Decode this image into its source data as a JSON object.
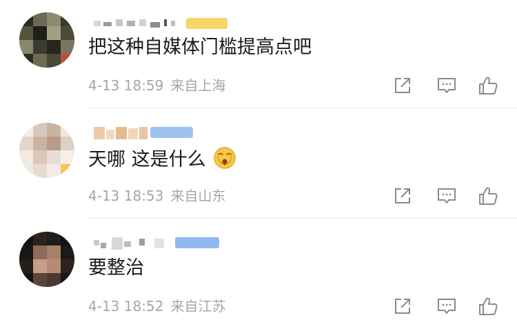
{
  "comments": [
    {
      "text": "把这种自媒体门槛提高点吧",
      "time": "4-13 18:59",
      "location": "来自上海",
      "badge_color": "#f6d66a"
    },
    {
      "text": "天哪 这是什么",
      "emoji": "shocked-face-emoji",
      "time": "4-13 18:53",
      "location": "来自山东",
      "badge_color": "#9fc3f0"
    },
    {
      "text": "要整治",
      "time": "4-13 18:52",
      "location": "来自江苏",
      "badge_color": "#8fb8ee"
    }
  ],
  "actions": [
    "share-icon",
    "comment-icon",
    "like-icon"
  ],
  "colors": {
    "text": "#1a1a1a",
    "meta": "#a5a5a5",
    "icon": "#8a8a8a",
    "divider": "#ececec"
  }
}
